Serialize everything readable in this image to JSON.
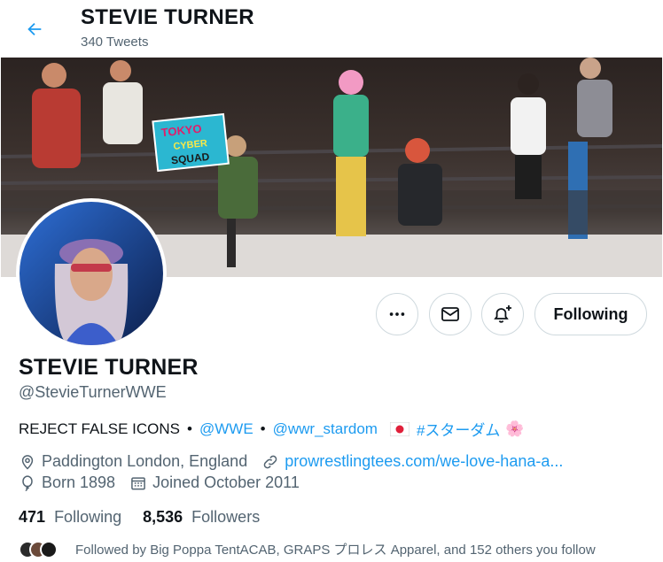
{
  "header": {
    "back_icon": "arrow-left-icon",
    "title": "STEVIE TURNER",
    "tweet_count": "340 Tweets"
  },
  "banner": {
    "sign_text": [
      "TOKYO",
      "CYBER",
      "SQUAD"
    ]
  },
  "actions": {
    "more_icon": "more-dots-icon",
    "message_icon": "envelope-icon",
    "notify_icon": "bell-plus-icon",
    "follow_label": "Following"
  },
  "profile": {
    "name": "STEVIE TURNER",
    "handle": "@StevieTurnerWWE",
    "bio": {
      "text1": "REJECT FALSE ICONS",
      "sep1": "•",
      "mention1": "@WWE",
      "sep2": "•",
      "mention2": "@wwr_stardom",
      "hashtag": "#スターダム",
      "blossom": "🌸"
    },
    "location": "Paddington London, England",
    "website": "prowrestlingtees.com/we-love-hana-a...",
    "born": "Born 1898",
    "joined": "Joined October 2011"
  },
  "stats": {
    "following_count": "471",
    "following_label": "Following",
    "followers_count": "8,536",
    "followers_label": "Followers"
  },
  "followed_by": "Followed by Big Poppa TentACAB, GRAPS プロレス Apparel, and 152 others you follow",
  "colors": {
    "accent": "#1d9bf0",
    "text": "#0f1419",
    "muted": "#536471",
    "border": "#cfd9de"
  }
}
